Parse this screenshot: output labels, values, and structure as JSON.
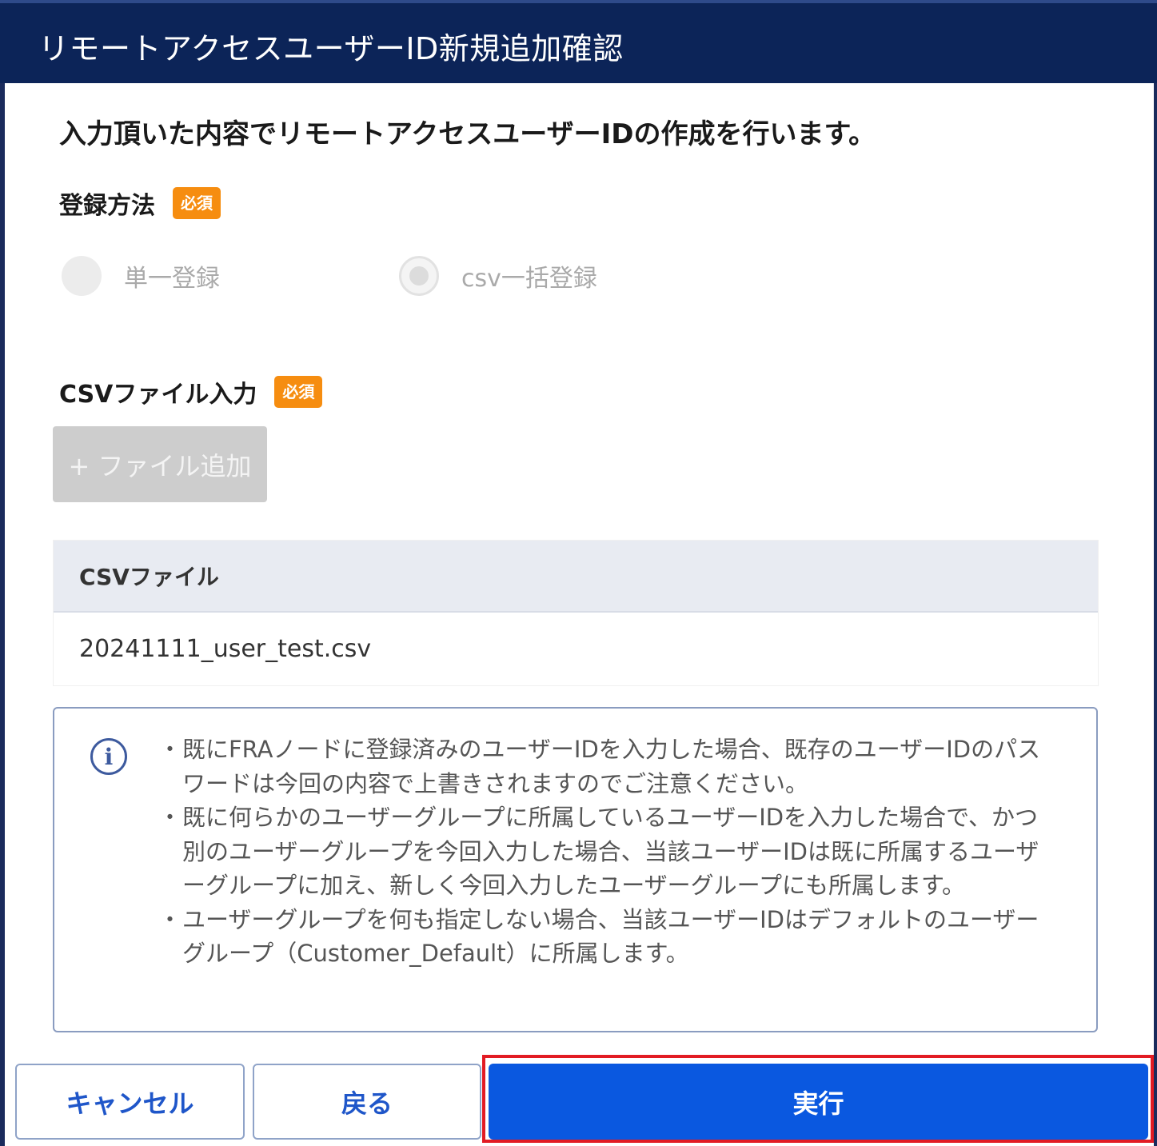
{
  "header": {
    "title": "リモートアクセスユーザーID新規追加確認"
  },
  "intro": {
    "text": "入力頂いた内容でリモートアクセスユーザーIDの作成を行います。"
  },
  "registration": {
    "label": "登録方法",
    "required_badge": "必須",
    "options": [
      {
        "label": "単一登録",
        "selected": false
      },
      {
        "label": "csv一括登録",
        "selected": true
      }
    ]
  },
  "csv_input": {
    "label": "CSVファイル入力",
    "required_badge": "必須",
    "add_file_button": "+ ファイル追加"
  },
  "file_table": {
    "header": "CSVファイル",
    "rows": [
      "20241111_user_test.csv"
    ]
  },
  "notice": {
    "icon": "info-icon",
    "items": [
      "既にFRAノードに登録済みのユーザーIDを入力した場合、既存のユーザーIDのパスワードは今回の内容で上書きされますのでご注意ください。",
      "既に何らかのユーザーグループに所属しているユーザーIDを入力した場合で、かつ別のユーザーグループを今回入力した場合、当該ユーザーIDは既に所属するユーザーグループに加え、新しく今回入力したユーザーグループにも所属します。",
      "ユーザーグループを何も指定しない場合、当該ユーザーIDはデフォルトのユーザーグループ（Customer_Default）に所属します。"
    ]
  },
  "actions": {
    "cancel": "キャンセル",
    "back": "戻る",
    "execute": "実行"
  },
  "colors": {
    "header_bg": "#0c2458",
    "badge": "#f68d10",
    "primary": "#0a58e0",
    "highlight": "#e21b23"
  }
}
